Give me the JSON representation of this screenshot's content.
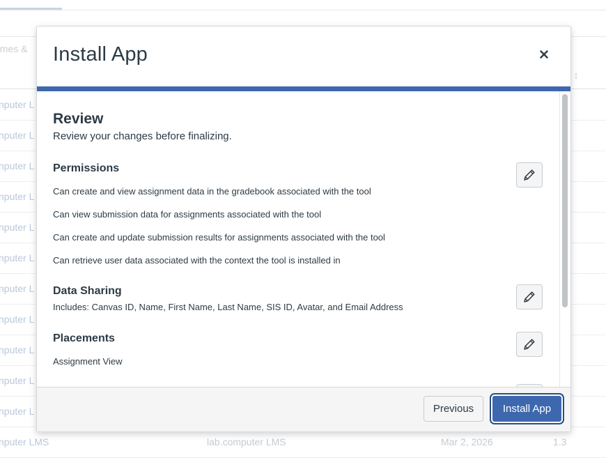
{
  "background": {
    "search_placeholder": "ames &",
    "sort_marker": "n ↕",
    "rows": [
      {
        "name": "nputer L",
        "domain": "",
        "date": "",
        "version": ""
      },
      {
        "name": "nputer L",
        "domain": "",
        "date": "",
        "version": ""
      },
      {
        "name": "nputer L",
        "domain": "",
        "date": "",
        "version": ""
      },
      {
        "name": "nputer L",
        "domain": "",
        "date": "",
        "version": ""
      },
      {
        "name": "nputer L",
        "domain": "",
        "date": "",
        "version": ""
      },
      {
        "name": "nputer L",
        "domain": "",
        "date": "",
        "version": ""
      },
      {
        "name": "nputer L",
        "domain": "",
        "date": "",
        "version": ""
      },
      {
        "name": "nputer L",
        "domain": "",
        "date": "",
        "version": ""
      },
      {
        "name": "nputer L",
        "domain": "",
        "date": "",
        "version": ""
      },
      {
        "name": "nputer L",
        "domain": "",
        "date": "",
        "version": ""
      },
      {
        "name": "nputer L",
        "domain": "",
        "date": "",
        "version": ""
      },
      {
        "name": "nputer LMS",
        "domain": "lab.computer LMS",
        "date": "Mar 2, 2026",
        "version": "1.3"
      }
    ]
  },
  "modal": {
    "title": "Install App",
    "close_icon": "close-icon",
    "accent_color": "#3d68ad",
    "review": {
      "title": "Review",
      "subtitle": "Review your changes before finalizing."
    },
    "permissions": {
      "title": "Permissions",
      "items": [
        "Can create and view assignment data in the gradebook associated with the tool",
        "Can view submission data for assignments associated with the tool",
        "Can create and update submission results for assignments associated with the tool",
        "Can retrieve user data associated with the context the tool is installed in"
      ]
    },
    "data_sharing": {
      "title": "Data Sharing",
      "text": "Includes: Canvas ID, Name, First Name, Last Name, SIS ID, Avatar, and Email Address"
    },
    "placements": {
      "title": "Placements",
      "items": [
        "Assignment View"
      ]
    },
    "edit_icon": "pencil-icon",
    "footer": {
      "previous_label": "Previous",
      "install_label": "Install App"
    }
  }
}
